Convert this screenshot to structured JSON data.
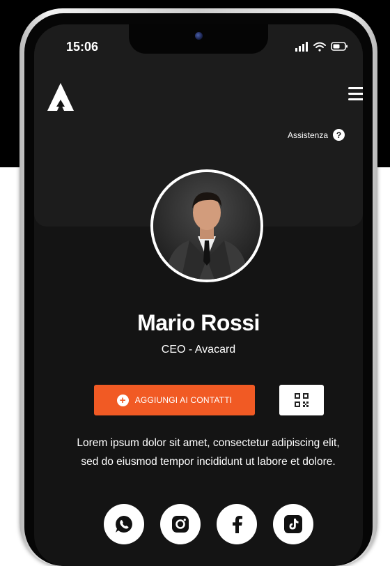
{
  "status_bar": {
    "time": "15:06"
  },
  "header": {
    "logo_icon": "avacard-logo-icon",
    "menu_icon": "hamburger-menu-icon"
  },
  "assistance": {
    "label": "Assistenza",
    "icon": "?"
  },
  "profile": {
    "name": "Mario Rossi",
    "role": "CEO - Avacard",
    "avatar": "profile-photo"
  },
  "actions": {
    "add_contact_label": "AGGIUNGI AI CONTATTI",
    "add_icon": "+",
    "qr_icon": "qr-code-icon"
  },
  "bio": "Lorem ipsum dolor sit amet, consectetur adipiscing elit, sed do eiusmod tempor incididunt ut labore et dolore.",
  "socials": [
    {
      "name": "whatsapp",
      "icon": "whatsapp-icon"
    },
    {
      "name": "instagram",
      "icon": "instagram-icon"
    },
    {
      "name": "facebook",
      "icon": "facebook-icon"
    },
    {
      "name": "tiktok",
      "icon": "tiktok-icon"
    }
  ],
  "colors": {
    "accent": "#f15a24",
    "screen_bg": "#141414",
    "panel_bg": "#1c1c1c",
    "text": "#ffffff"
  }
}
